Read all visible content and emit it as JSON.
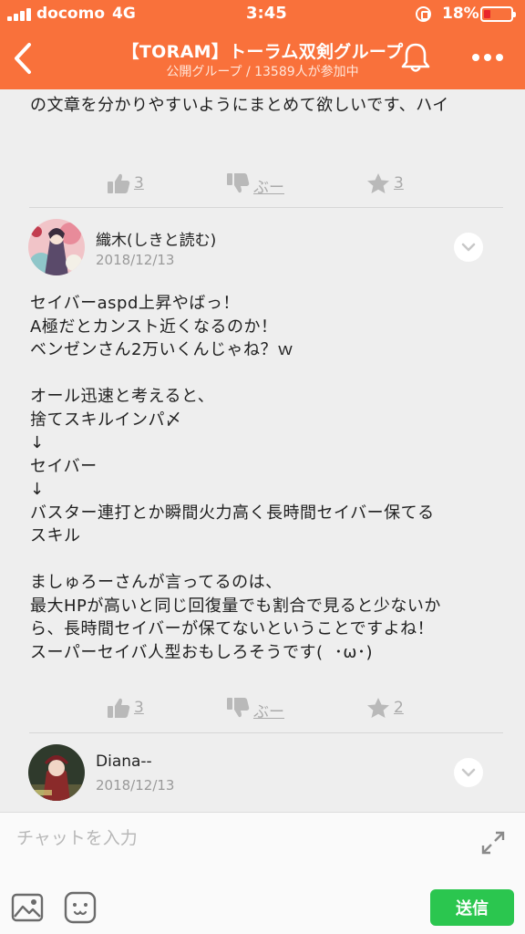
{
  "status_bar": {
    "carrier": "docomo",
    "network": "4G",
    "time": "3:45",
    "battery_percent": "18%",
    "battery_level": 0.18
  },
  "header": {
    "title": "【TORAM】トーラム双剣グループ",
    "subtitle": "公開グループ / 13589人が参加中",
    "back_icon": "chevron-left-icon",
    "bell_icon": "bell-icon",
    "more_icon": "more-dots-icon"
  },
  "posts": [
    {
      "text": "の文章を分かりやすいようにまとめて欲しいです、ハイ",
      "likes": "3",
      "dislike_label": "ぶー",
      "stars": "3"
    },
    {
      "author": "織木(しきと読む)",
      "date": "2018/12/13",
      "text": "セイバーaspd上昇やばっ！\nA極だとカンスト近くなるのか！\nベンゼンさん2万いくんじゃね？ｗ\n\nオール迅速と考えると、\n捨てスキルインパ〆\n↓\nセイバー\n↓\nバスター連打とか瞬間火力高く長時間セイバー保てる\nスキル\n\nましゅろーさんが言ってるのは、\n最大HPが高いと同じ回復量でも割合で見ると少ないか\nら、長時間セイバーが保てないということですよね！\nスーパーセイバ人型おもしろそうです(  ･ω･)",
      "likes": "3",
      "dislike_label": "ぶー",
      "stars": "2"
    },
    {
      "author": "Diana--",
      "date": "2018/12/13"
    }
  ],
  "composer": {
    "placeholder": "チャットを入力",
    "send_label": "送信",
    "expand_icon": "expand-icon",
    "image_icon": "image-icon",
    "sticker_icon": "sticker-icon"
  },
  "colors": {
    "header_bg": "#f9713b",
    "send_bg": "#2bc64f",
    "page_bg": "#eeeeee",
    "action_gray": "#aaaaaa"
  }
}
